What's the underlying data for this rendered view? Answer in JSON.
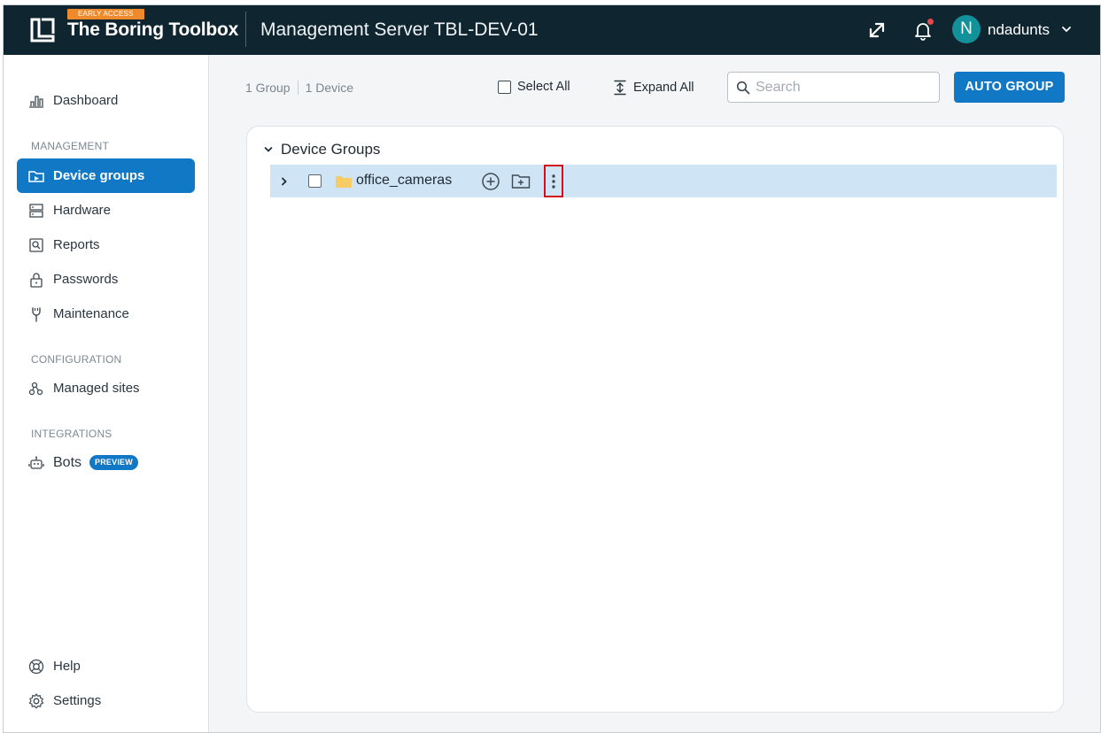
{
  "header": {
    "early_access": "EARLY ACCESS",
    "app_name": "The Boring Toolbox",
    "server_title": "Management Server TBL-DEV-01",
    "avatar_initial": "N",
    "username": "ndadunts",
    "icons": [
      "logo-icon",
      "expand-icon",
      "bell-icon",
      "chevron-down-icon"
    ],
    "colors": {
      "bar": "#0f2530",
      "avatar": "#12919a",
      "badge": "#ef8a2c",
      "notification": "#e5484d"
    }
  },
  "sidebar": {
    "dashboard": "Dashboard",
    "management_label": "MANAGEMENT",
    "device_groups": "Device groups",
    "hardware": "Hardware",
    "reports": "Reports",
    "passwords": "Passwords",
    "maintenance": "Maintenance",
    "configuration_label": "CONFIGURATION",
    "managed_sites": "Managed sites",
    "integrations_label": "INTEGRATIONS",
    "bots": "Bots",
    "bots_badge": "PREVIEW",
    "help": "Help",
    "settings": "Settings",
    "active_color": "#1178c6"
  },
  "toolbar": {
    "group_count": "1 Group",
    "device_count": "1 Device",
    "select_all": "Select All",
    "expand_all": "Expand All",
    "search_placeholder": "Search",
    "auto_group": "AUTO GROUP"
  },
  "tree": {
    "root_label": "Device Groups",
    "groups": [
      {
        "name": "office_cameras"
      }
    ]
  }
}
